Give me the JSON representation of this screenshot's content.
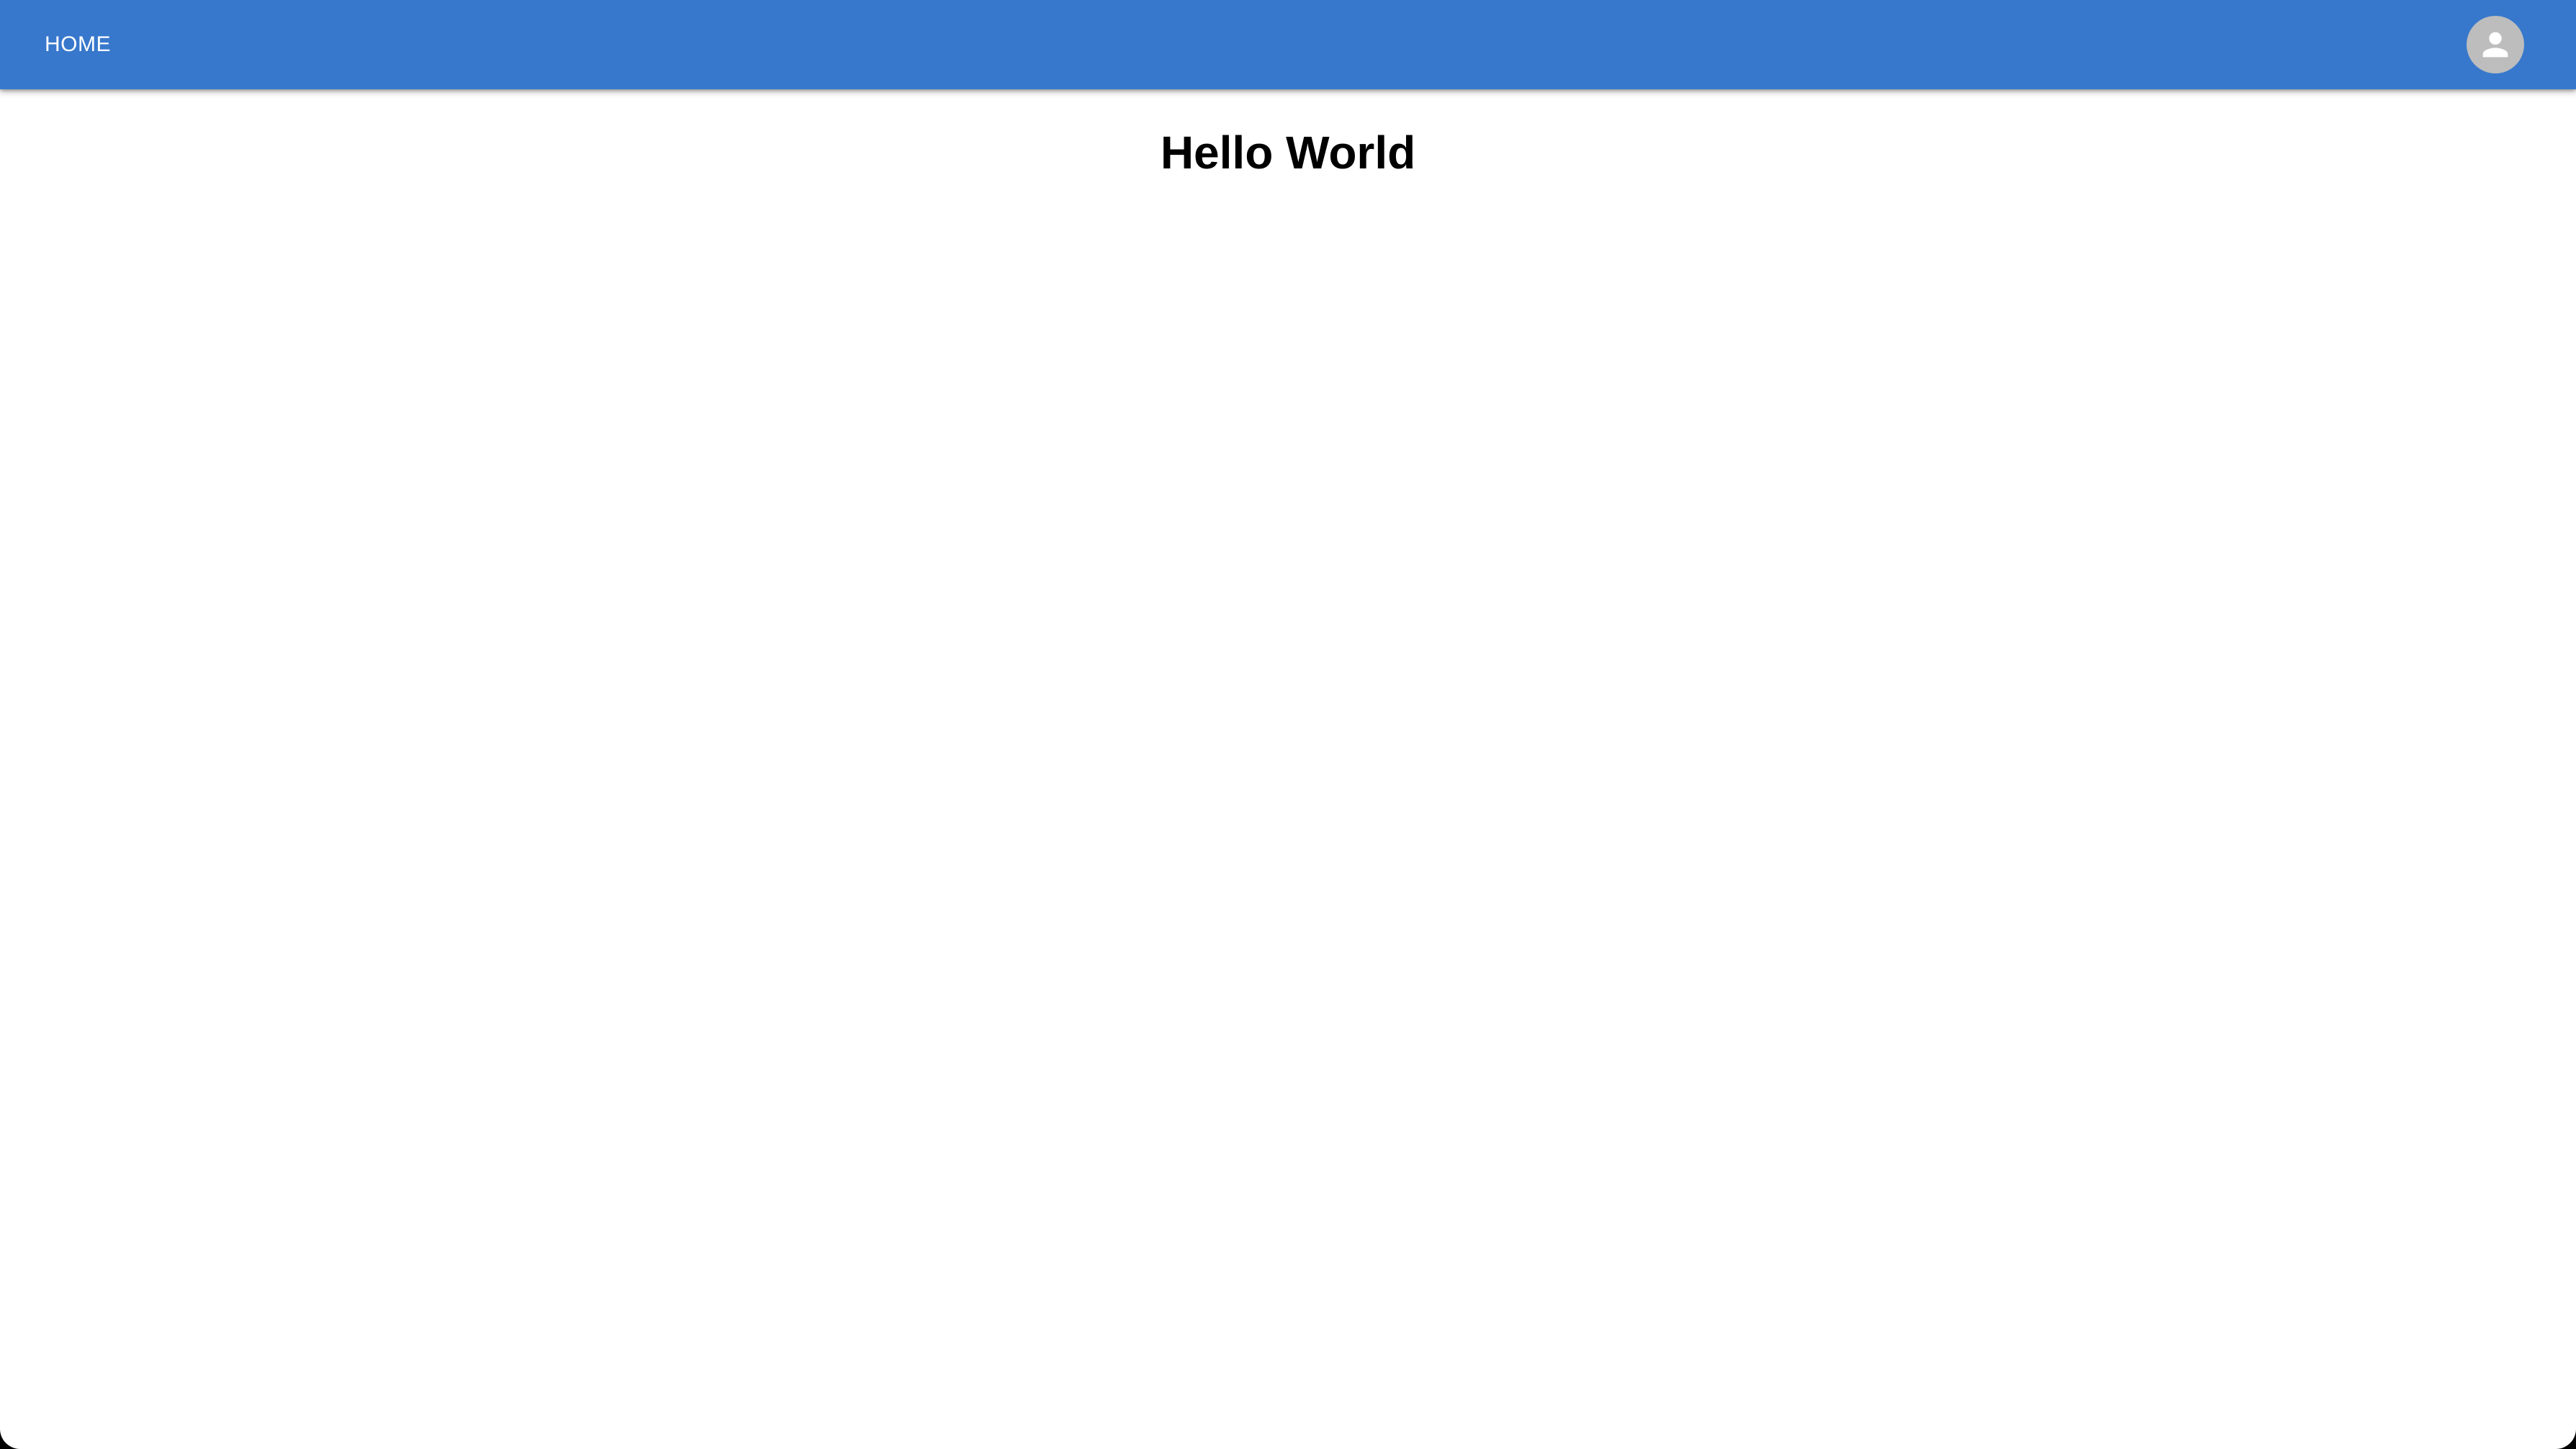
{
  "app_bar": {
    "home_label": "HOME",
    "avatar_icon": "person-icon",
    "background_color": "#3778cc"
  },
  "main": {
    "title": "Hello World"
  }
}
